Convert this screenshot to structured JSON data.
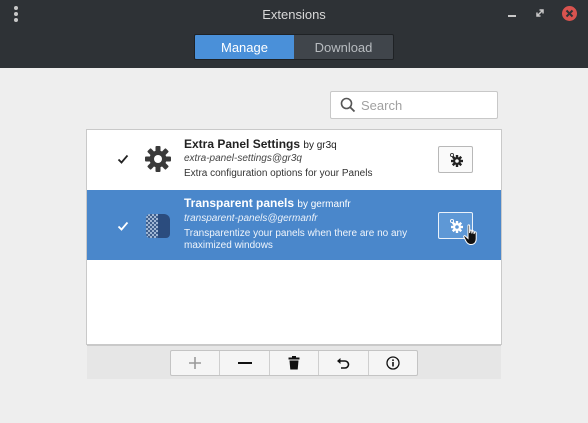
{
  "window": {
    "title": "Extensions"
  },
  "tabs": [
    {
      "label": "Manage",
      "active": true
    },
    {
      "label": "Download",
      "active": false
    }
  ],
  "search": {
    "placeholder": "Search",
    "value": ""
  },
  "extensions": [
    {
      "name": "Extra Panel Settings",
      "author": "by gr3q",
      "uuid": "extra-panel-settings@gr3q",
      "description": "Extra configuration options for your Panels",
      "enabled": true,
      "selected": false,
      "icon": "gear-icon"
    },
    {
      "name": "Transparent panels",
      "author": "by germanfr",
      "uuid": "transparent-panels@germanfr",
      "description": "Transparentize your panels when there are no any maximized windows",
      "enabled": true,
      "selected": true,
      "icon": "transparent-panels-icon"
    }
  ],
  "toolbar": {
    "buttons": [
      "add-icon",
      "remove-icon",
      "trash-icon",
      "undo-icon",
      "info-icon"
    ]
  },
  "colors": {
    "header_bg": "#2e3236",
    "accent": "#4a90d9",
    "selected_row": "#4a87cb",
    "close_button": "#d9534f"
  }
}
